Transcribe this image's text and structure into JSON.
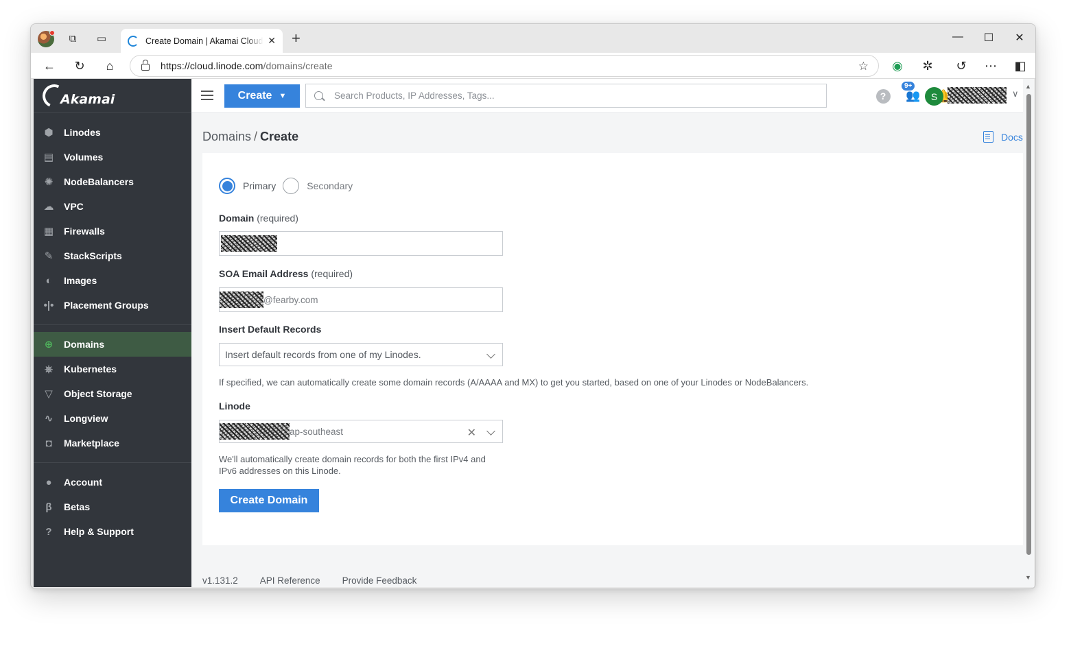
{
  "browser": {
    "tab_title": "Create Domain | Akamai Cloud Manager",
    "url_host": "https://cloud.linode.com",
    "url_path": "/domains/create",
    "window_controls": {
      "minimize": "—",
      "maximize": "☐",
      "close": "✕"
    }
  },
  "app": {
    "logo_text": "Akamai",
    "create_label": "Create",
    "search_placeholder": "Search Products, IP Addresses, Tags...",
    "notifications_badge": "9+",
    "avatar_initial": "S"
  },
  "sidebar": {
    "groups": [
      [
        {
          "label": "Linodes",
          "icon": "linode-icon"
        },
        {
          "label": "Volumes",
          "icon": "volume-icon"
        },
        {
          "label": "NodeBalancers",
          "icon": "nodebalancer-icon"
        },
        {
          "label": "VPC",
          "icon": "vpc-icon"
        },
        {
          "label": "Firewalls",
          "icon": "firewall-icon"
        },
        {
          "label": "StackScripts",
          "icon": "stackscript-icon"
        },
        {
          "label": "Images",
          "icon": "image-icon"
        },
        {
          "label": "Placement Groups",
          "icon": "placement-group-icon"
        }
      ],
      [
        {
          "label": "Domains",
          "icon": "globe-icon",
          "active": true
        },
        {
          "label": "Kubernetes",
          "icon": "kubernetes-icon"
        },
        {
          "label": "Object Storage",
          "icon": "bucket-icon"
        },
        {
          "label": "Longview",
          "icon": "pulse-icon"
        },
        {
          "label": "Marketplace",
          "icon": "bag-icon"
        }
      ],
      [
        {
          "label": "Account",
          "icon": "person-icon"
        },
        {
          "label": "Betas",
          "icon": "beta-icon"
        },
        {
          "label": "Help & Support",
          "icon": "help-icon"
        }
      ]
    ]
  },
  "page": {
    "breadcrumb_parent": "Domains",
    "breadcrumb_sep": "/",
    "breadcrumb_current": "Create",
    "docs_label": "Docs"
  },
  "form": {
    "type_primary": "Primary",
    "type_secondary": "Secondary",
    "selected_type": "Primary",
    "domain_label": "Domain",
    "required_suffix": "(required)",
    "soa_label": "SOA Email Address",
    "soa_value_suffix": "@fearby.com",
    "insert_label": "Insert Default Records",
    "insert_value": "Insert default records from one of my Linodes.",
    "insert_helper": "If specified, we can automatically create some domain records (A/AAAA and MX) to get you started, based on one of your Linodes or NodeBalancers.",
    "linode_label": "Linode",
    "linode_value_suffix": "ap-southeast",
    "linode_helper": "We'll automatically create domain records for both the first IPv4 and IPv6 addresses on this Linode.",
    "submit_label": "Create Domain"
  },
  "footer": {
    "version": "v1.131.2",
    "api_reference": "API Reference",
    "feedback": "Provide Feedback"
  }
}
